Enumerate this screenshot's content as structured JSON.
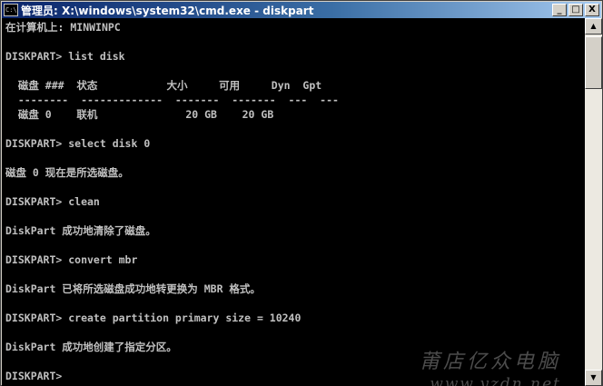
{
  "window": {
    "title": "管理员: X:\\windows\\system32\\cmd.exe - diskpart",
    "icon_text": "C:\\",
    "buttons": {
      "minimize": "_",
      "maximize": "□",
      "close": "X"
    }
  },
  "console": {
    "lines": [
      "在计算机上: MINWINPC",
      "",
      "DISKPART> list disk",
      "",
      "  磁盘 ###  状态           大小     可用     Dyn  Gpt",
      "  --------  -------------  -------  -------  ---  ---",
      "  磁盘 0    联机              20 GB    20 GB",
      "",
      "DISKPART> select disk 0",
      "",
      "磁盘 0 现在是所选磁盘。",
      "",
      "DISKPART> clean",
      "",
      "DiskPart 成功地清除了磁盘。",
      "",
      "DISKPART> convert mbr",
      "",
      "DiskPart 已将所选磁盘成功地转更换为 MBR 格式。",
      "",
      "DISKPART> create partition primary size = 10240",
      "",
      "DiskPart 成功地创建了指定分区。",
      "",
      "DISKPART>"
    ]
  },
  "scrollbar": {
    "up_arrow": "▲",
    "down_arrow": "▼"
  },
  "watermark": {
    "line1": "莆店亿众电脑",
    "line2": "www.yzdn.net"
  },
  "colors": {
    "console_bg": "#000000",
    "console_text": "#c0c0c0",
    "title_bar": "#0a246a"
  }
}
